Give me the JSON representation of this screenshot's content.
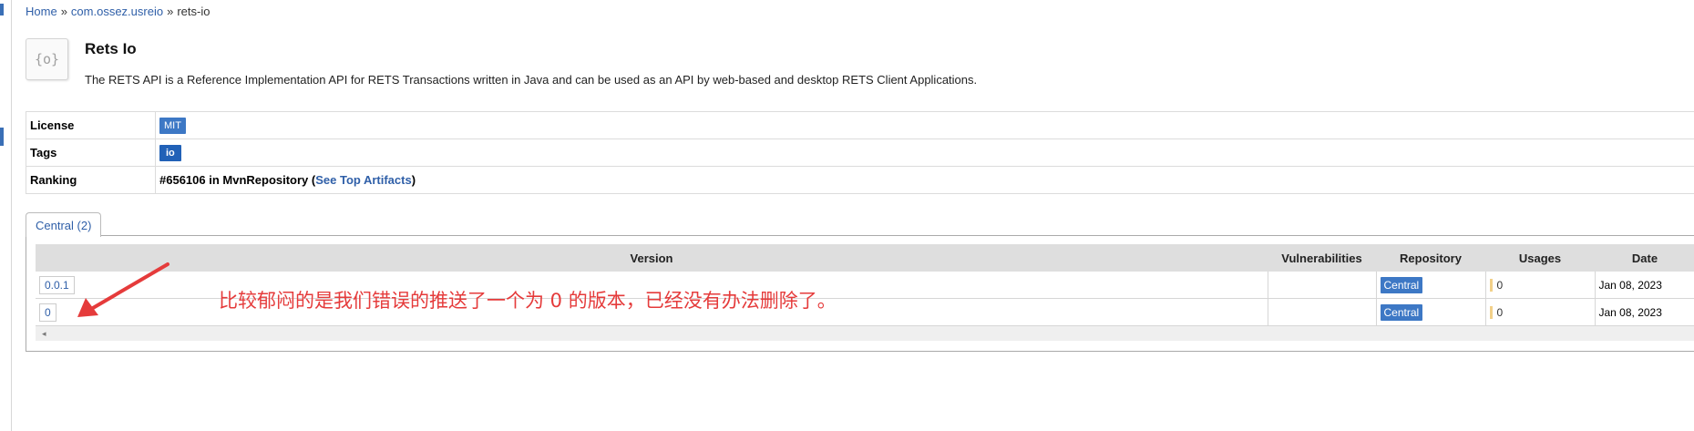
{
  "breadcrumb": {
    "home": "Home",
    "sep1": "»",
    "group": "com.ossez.usreio",
    "sep2": "»",
    "current": "rets-io"
  },
  "artifact": {
    "logo_text": "{o}",
    "title": "Rets Io",
    "description": "The RETS API is a Reference Implementation API for RETS Transactions written in Java and can be used as an API by web-based and desktop RETS Client Applications."
  },
  "info": {
    "license_label": "License",
    "license_value": "MIT",
    "tags_label": "Tags",
    "tags_value": "io",
    "ranking_label": "Ranking",
    "ranking_text": "#656106 in MvnRepository (",
    "ranking_link": "See Top Artifacts",
    "ranking_close": ")"
  },
  "tab": {
    "label": "Central (2)"
  },
  "versions_table": {
    "columns": [
      "Version",
      "Vulnerabilities",
      "Repository",
      "Usages",
      "Date"
    ],
    "rows": [
      {
        "version": "0.0.1",
        "vulnerabilities": "",
        "repository": "Central",
        "usages": "0",
        "date": "Jan 08, 2023"
      },
      {
        "version": "0",
        "vulnerabilities": "",
        "repository": "Central",
        "usages": "0",
        "date": "Jan 08, 2023"
      }
    ],
    "scroll_arrow": "◂"
  },
  "annotation": {
    "text": "比较郁闷的是我们错误的推送了一个为 0 的版本，已经没有办法删除了。",
    "color": "#e53b3b"
  },
  "colors": {
    "link": "#2f5fa8",
    "badge": "#3d78c5",
    "tag_badge": "#2161b7",
    "header_bg": "#dedede",
    "usage_bar": "#f2d089"
  }
}
